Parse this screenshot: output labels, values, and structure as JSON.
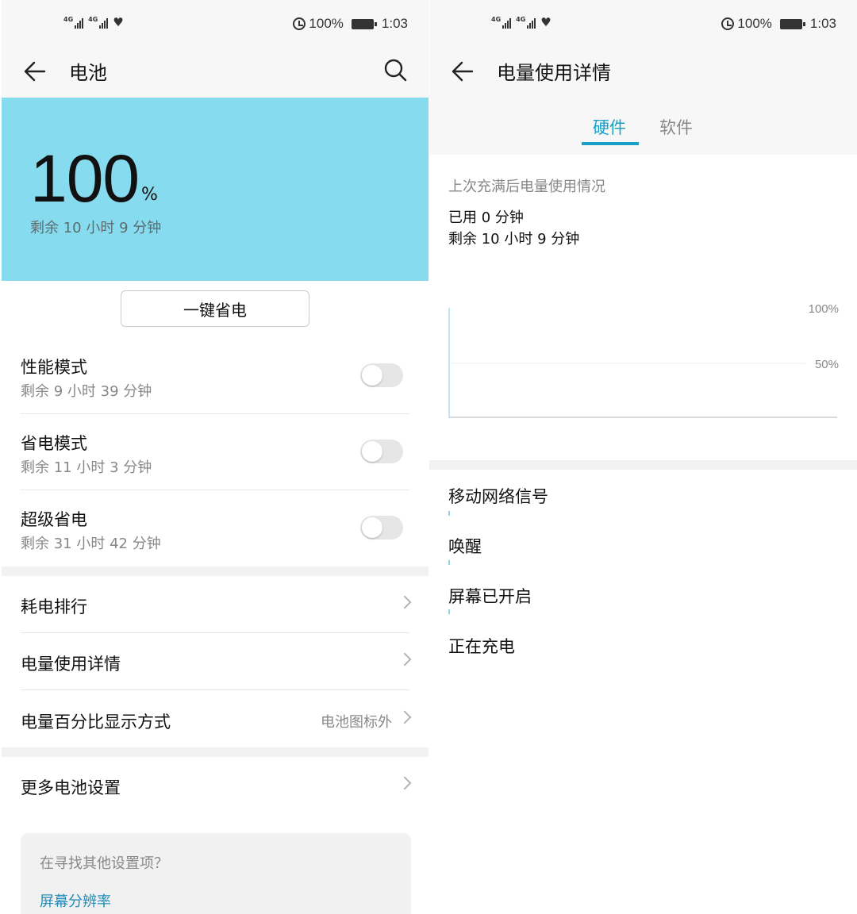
{
  "status": {
    "net_tag_1": "4G",
    "net_tag_2": "4G",
    "battery_pct": "100%",
    "time": "1:03"
  },
  "battery_page": {
    "title": "电池",
    "level": "100",
    "level_unit": "%",
    "remaining": "剩余 10 小时 9 分钟",
    "save_button": "一键省电",
    "modes": [
      {
        "label": "性能模式",
        "sub": "剩余 9 小时 39 分钟",
        "on": false
      },
      {
        "label": "省电模式",
        "sub": "剩余 11 小时 3 分钟",
        "on": false
      },
      {
        "label": "超级省电",
        "sub": "剩余 31 小时 42 分钟",
        "on": false
      }
    ],
    "nav": [
      {
        "label": "耗电排行",
        "value": ""
      },
      {
        "label": "电量使用详情",
        "value": ""
      },
      {
        "label": "电量百分比显示方式",
        "value": "电池图标外"
      },
      {
        "label": "更多电池设置",
        "value": ""
      }
    ],
    "find": {
      "question": "在寻找其他设置项？",
      "link": "屏幕分辨率"
    }
  },
  "detail_page": {
    "title": "电量使用详情",
    "tabs": [
      {
        "label": "硬件",
        "active": true
      },
      {
        "label": "软件",
        "active": false
      }
    ],
    "caption": "上次充满后电量使用情况",
    "used": "已用 0 分钟",
    "remaining": "剩余 10 小时 9 分钟",
    "hardware": [
      {
        "label": "移动网络信号"
      },
      {
        "label": "唤醒"
      },
      {
        "label": "屏幕已开启"
      },
      {
        "label": "正在充电"
      }
    ]
  },
  "chart_data": {
    "type": "line",
    "title": "",
    "xlabel": "",
    "ylabel": "",
    "yticks": [
      "100%",
      "50%"
    ],
    "ylim": [
      0,
      100
    ],
    "series": [
      {
        "values": [
          100
        ]
      }
    ]
  },
  "colors": {
    "hero_bg": "#87dbee",
    "accent": "#19a0c7",
    "link": "#1f8bb8"
  }
}
